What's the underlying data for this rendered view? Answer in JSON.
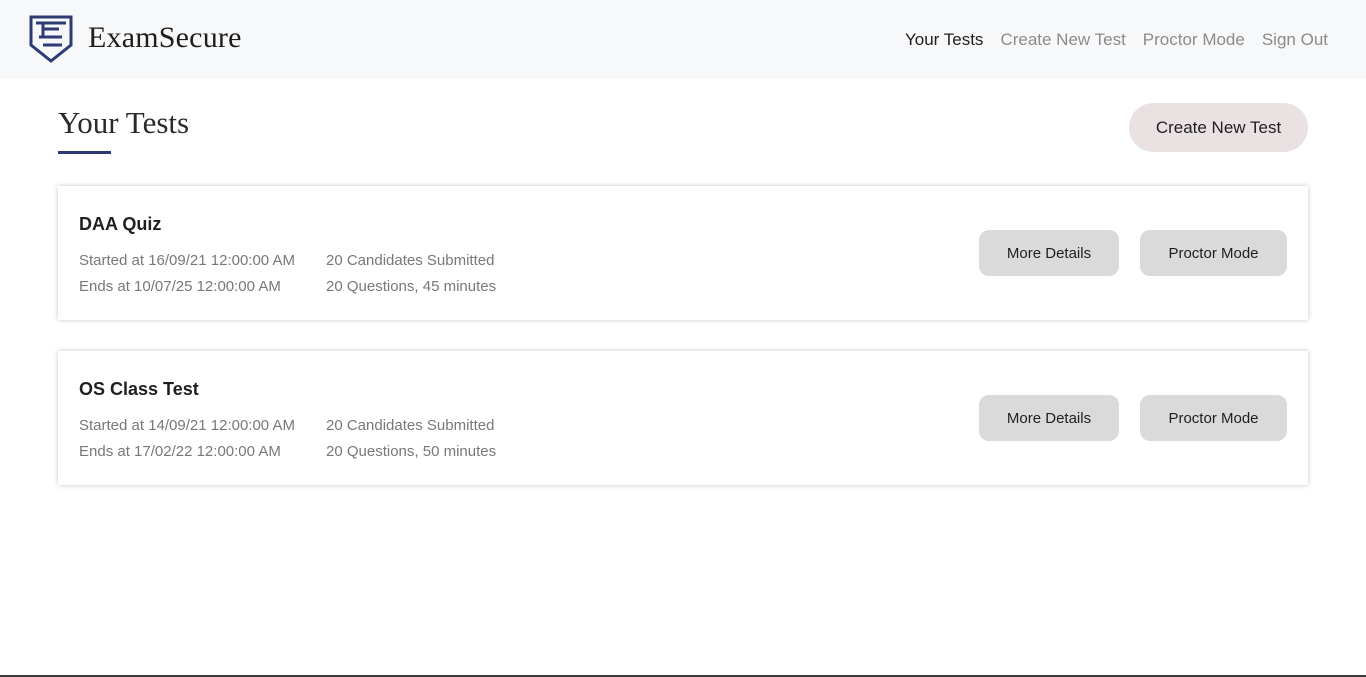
{
  "brand": {
    "name": "ExamSecure",
    "logo_icon": "shield-e-logo-icon",
    "logo_color": "#2e3a72"
  },
  "nav": {
    "links": [
      {
        "label": "Your Tests",
        "active": true
      },
      {
        "label": "Create New Test",
        "active": false
      },
      {
        "label": "Proctor Mode",
        "active": false
      },
      {
        "label": "Sign Out",
        "active": false
      }
    ]
  },
  "page": {
    "title": "Your Tests",
    "create_button_label": "Create New Test"
  },
  "tests": [
    {
      "name": "DAA Quiz",
      "started": "Started at 16/09/21 12:00:00 AM",
      "ends": "Ends at 10/07/25 12:00:00 AM",
      "candidates": "20 Candidates Submitted",
      "questions": "20 Questions, 45 minutes",
      "details_label": "More Details",
      "proctor_label": "Proctor Mode"
    },
    {
      "name": "OS Class Test",
      "started": "Started at 14/09/21 12:00:00 AM",
      "ends": "Ends at 17/02/22 12:00:00 AM",
      "candidates": "20 Candidates Submitted",
      "questions": "20 Questions, 50 minutes",
      "details_label": "More Details",
      "proctor_label": "Proctor Mode"
    }
  ],
  "colors": {
    "accent": "#2e3a72",
    "navbar_bg": "#f7f8fa",
    "create_button_bg": "#e9e1e2",
    "card_button_bg": "#dadada"
  }
}
